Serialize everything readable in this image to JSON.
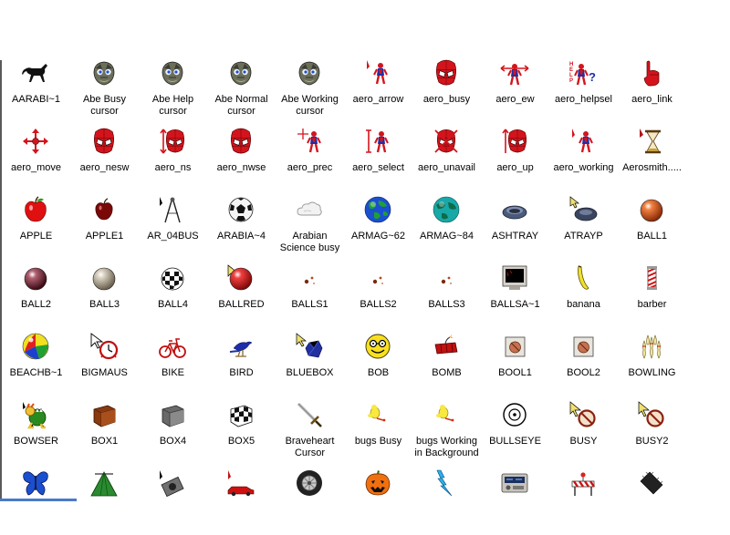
{
  "icons": [
    {
      "label": "AARABI~1",
      "icon": "horse-icon"
    },
    {
      "label": "Abe Busy\ncursor",
      "icon": "abe-head-icon"
    },
    {
      "label": "Abe Help\ncursor",
      "icon": "abe-head-icon"
    },
    {
      "label": "Abe Normal\ncursor",
      "icon": "abe-head-icon"
    },
    {
      "label": "Abe Working\ncursor",
      "icon": "abe-head-icon"
    },
    {
      "label": "aero_arrow",
      "icon": "spiderman-arrow-icon"
    },
    {
      "label": "aero_busy",
      "icon": "spiderman-head-icon"
    },
    {
      "label": "aero_ew",
      "icon": "spiderman-ew-icon"
    },
    {
      "label": "aero_helpsel",
      "icon": "help-question-icon"
    },
    {
      "label": "aero_link",
      "icon": "hand-pointer-icon"
    },
    {
      "label": "aero_move",
      "icon": "move-arrows-icon"
    },
    {
      "label": "aero_nesw",
      "icon": "spiderman-head-icon"
    },
    {
      "label": "aero_ns",
      "icon": "spiderman-ns-icon"
    },
    {
      "label": "aero_nwse",
      "icon": "spiderman-head-icon"
    },
    {
      "label": "aero_prec",
      "icon": "spiderman-crosshair-icon"
    },
    {
      "label": "aero_select",
      "icon": "spiderman-text-icon"
    },
    {
      "label": "aero_unavail",
      "icon": "spiderman-unavailable-icon"
    },
    {
      "label": "aero_up",
      "icon": "spiderman-up-icon"
    },
    {
      "label": "aero_working",
      "icon": "spiderman-arrow-icon"
    },
    {
      "label": "Aerosmith.....",
      "icon": "hourglass-icon"
    },
    {
      "label": "APPLE",
      "icon": "red-apple-icon"
    },
    {
      "label": "APPLE1",
      "icon": "dark-apple-icon"
    },
    {
      "label": "AR_04BUS",
      "icon": "compass-icon"
    },
    {
      "label": "ARABIA~4",
      "icon": "soccer-ball-icon"
    },
    {
      "label": "Arabian\nScience busy",
      "icon": "cloud-icon"
    },
    {
      "label": "ARMAG~62",
      "icon": "globe-icon"
    },
    {
      "label": "ARMAG~84",
      "icon": "teal-globe-icon"
    },
    {
      "label": "ASHTRAY",
      "icon": "ashtray-icon"
    },
    {
      "label": "ATRAYP",
      "icon": "ashtray-pointer-icon"
    },
    {
      "label": "BALL1",
      "icon": "orange-ball-icon"
    },
    {
      "label": "BALL2",
      "icon": "maroon-ball-icon"
    },
    {
      "label": "BALL3",
      "icon": "silver-ball-icon"
    },
    {
      "label": "BALL4",
      "icon": "checkered-ball-icon"
    },
    {
      "label": "BALLRED",
      "icon": "red-ball-pointer-icon"
    },
    {
      "label": "BALLS1",
      "icon": "small-balls-icon"
    },
    {
      "label": "BALLS2",
      "icon": "small-balls-icon"
    },
    {
      "label": "BALLS3",
      "icon": "small-balls-icon"
    },
    {
      "label": "BALLSA~1",
      "icon": "monitor-icon"
    },
    {
      "label": "banana",
      "icon": "banana-icon"
    },
    {
      "label": "barber",
      "icon": "barber-pole-icon"
    },
    {
      "label": "BEACHB~1",
      "icon": "beach-ball-icon"
    },
    {
      "label": "BIGMAUS",
      "icon": "alarm-clock-pointer-icon"
    },
    {
      "label": "BIKE",
      "icon": "bicycle-icon"
    },
    {
      "label": "BIRD",
      "icon": "bird-icon"
    },
    {
      "label": "BLUEBOX",
      "icon": "blue-box-pointer-icon"
    },
    {
      "label": "BOB",
      "icon": "smiley-glasses-icon"
    },
    {
      "label": "BOMB",
      "icon": "dynamite-icon"
    },
    {
      "label": "BOOL1",
      "icon": "spinner-box-icon"
    },
    {
      "label": "BOOL2",
      "icon": "spinner-box-icon"
    },
    {
      "label": "BOWLING",
      "icon": "bowling-pins-icon"
    },
    {
      "label": "BOWSER",
      "icon": "bowser-icon"
    },
    {
      "label": "BOX1",
      "icon": "brown-box-icon"
    },
    {
      "label": "BOX4",
      "icon": "gray-box-icon"
    },
    {
      "label": "BOX5",
      "icon": "checker-box-icon"
    },
    {
      "label": "Braveheart\nCursor",
      "icon": "sword-icon"
    },
    {
      "label": "bugs Busy",
      "icon": "bug-icon"
    },
    {
      "label": "bugs Working\nin Background",
      "icon": "bug-icon"
    },
    {
      "label": "BULLSEYE",
      "icon": "bullseye-icon"
    },
    {
      "label": "BUSY",
      "icon": "busy-circle-pointer-icon"
    },
    {
      "label": "BUSY2",
      "icon": "busy-circle-pointer-icon"
    },
    {
      "label": "",
      "icon": "butterfly-icon"
    },
    {
      "label": "",
      "icon": "tent-icon"
    },
    {
      "label": "",
      "icon": "camera-icon"
    },
    {
      "label": "",
      "icon": "red-car-icon"
    },
    {
      "label": "",
      "icon": "tire-icon"
    },
    {
      "label": "",
      "icon": "pumpkin-icon"
    },
    {
      "label": "",
      "icon": "lightning-icon"
    },
    {
      "label": "",
      "icon": "radio-icon"
    },
    {
      "label": "",
      "icon": "construction-barrier-icon"
    },
    {
      "label": "",
      "icon": "chip-icon"
    }
  ]
}
